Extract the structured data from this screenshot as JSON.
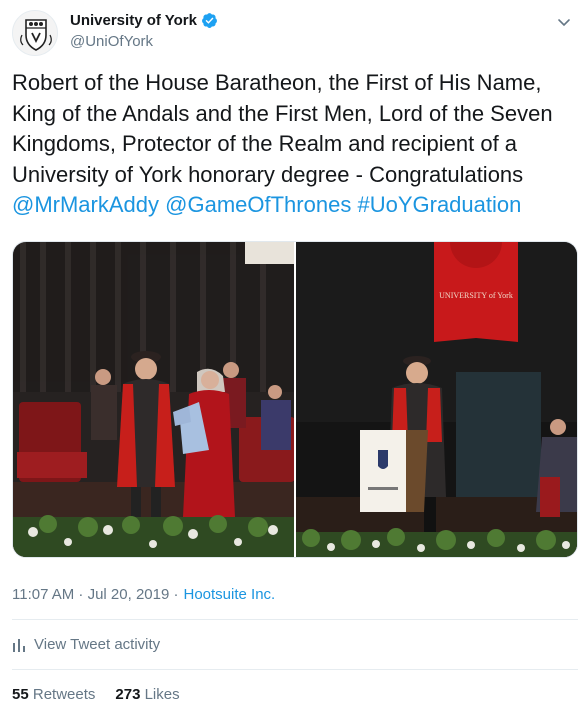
{
  "account": {
    "name": "University of York",
    "handle": "@UniOfYork",
    "verified": true
  },
  "tweet": {
    "text_main": "Robert of the House Baratheon, the First of His Name, King of the Andals and the First Men, Lord of the Seven Kingdoms, Protector of the Realm and recipient of a University of York honorary degree - Congratulations ",
    "mentions": [
      "@MrMarkAddy",
      "@GameOfThrones",
      "#UoYGraduation"
    ]
  },
  "media": {
    "photo1_desc": "photo-ceremony-handshake",
    "photo2_desc": "photo-ceremony-lectern",
    "banner_text": "UNIVERSITY of York"
  },
  "meta": {
    "time": "11:07 AM · Jul 20, 2019 ·",
    "source": "Hootsuite Inc."
  },
  "activity": {
    "label": "View Tweet activity"
  },
  "stats": {
    "retweets_count": "55",
    "retweets_label": "Retweets",
    "likes_count": "273",
    "likes_label": "Likes"
  },
  "colors": {
    "link": "#1b95e0",
    "verified": "#1da1f2",
    "muted": "#657786"
  }
}
